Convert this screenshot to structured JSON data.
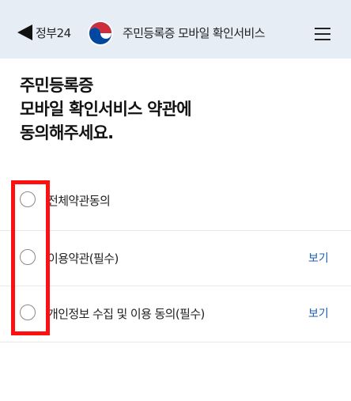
{
  "header": {
    "back_label": "정부24",
    "title": "주민등록증 모바일 확인서비스",
    "back_icon": "back-triangle-icon",
    "emblem_icon": "taeguk-emblem-icon",
    "menu_icon": "hamburger-menu-icon"
  },
  "heading": {
    "line1": "주민등록증",
    "line2": "모바일 확인서비스 약관에",
    "line3": "동의해주세요."
  },
  "agreements": [
    {
      "label": "전체약관동의",
      "view": ""
    },
    {
      "label": "이용약관(필수)",
      "view": "보기"
    },
    {
      "label": "개인정보 수집 및 이용 동의(필수)",
      "view": "보기"
    }
  ],
  "colors": {
    "header_bg": "#e6edf4",
    "link": "#1f5fb4",
    "highlight": "#ff1010",
    "emblem_red": "#cd2e3a",
    "emblem_blue": "#0047a0"
  }
}
